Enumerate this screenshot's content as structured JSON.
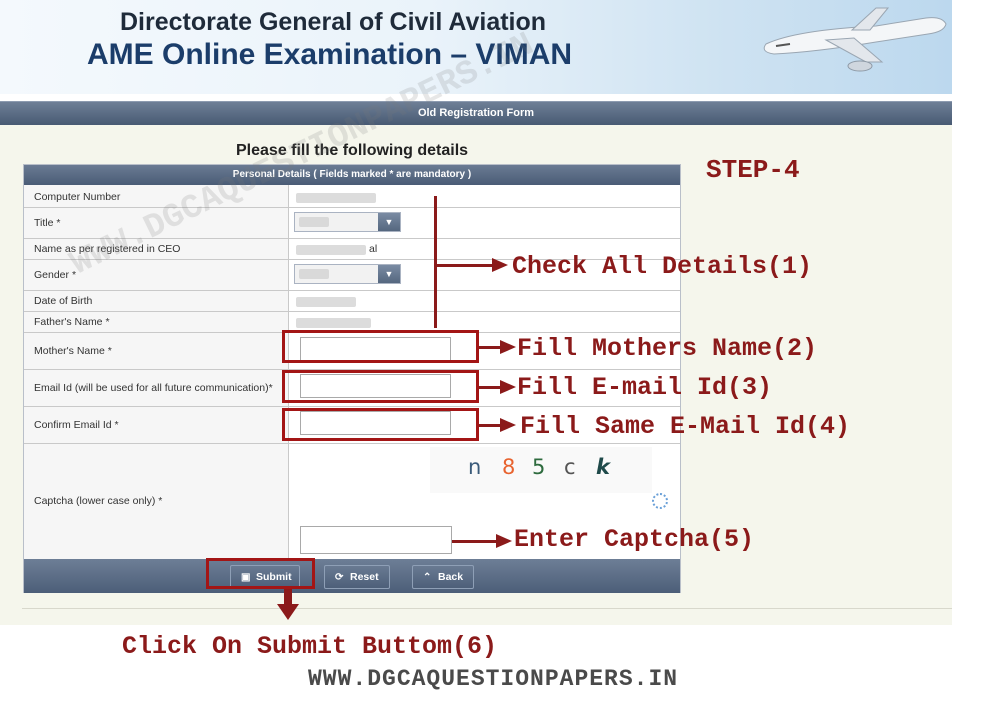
{
  "header": {
    "org_title": "Directorate General of Civil Aviation",
    "app_title": "AME Online Examination – VIMAN"
  },
  "form_bar": {
    "title": "Old Registration Form"
  },
  "instruction": "Please fill the following details",
  "panel": {
    "heading": "Personal Details ( Fields marked * are mandatory )",
    "labels": {
      "computer_number": "Computer Number",
      "title": "Title *",
      "name": "Name as per registered in CEO",
      "gender": "Gender *",
      "dob": "Date of Birth",
      "father": "Father's Name *",
      "mother": "Mother's Name *",
      "email": "Email Id (will be used for all future communication)*",
      "confirm_email": "Confirm Email Id *",
      "captcha": "Captcha (lower case only) *"
    },
    "name_partial": "al",
    "captcha_chars": [
      {
        "char": "n",
        "color": "#3b5b7a"
      },
      {
        "char": "8",
        "color": "#e8632f"
      },
      {
        "char": "5",
        "color": "#2e6b3e"
      },
      {
        "char": "c",
        "color": "#555555"
      },
      {
        "char": "k",
        "color": "#1f4a4a"
      }
    ]
  },
  "buttons": {
    "submit": "Submit",
    "reset": "Reset",
    "back": "Back"
  },
  "annotations": {
    "step": "STEP-4",
    "check_details": "Check All Details(1)",
    "mothers_name": "Fill Mothers Name(2)",
    "email": "Fill E-mail Id(3)",
    "same_email": "Fill Same E-Mail Id(4)",
    "captcha": "Enter Captcha(5)",
    "submit": "Click On Submit Buttom(6)"
  },
  "watermark": "WWW.DGCAQUESTIONPAPERS.IN",
  "footer_site": "WWW.DGCAQUESTIONPAPERS.IN",
  "colors": {
    "annotation": "#8b1a1a",
    "header_bar": "#4a5c76"
  }
}
